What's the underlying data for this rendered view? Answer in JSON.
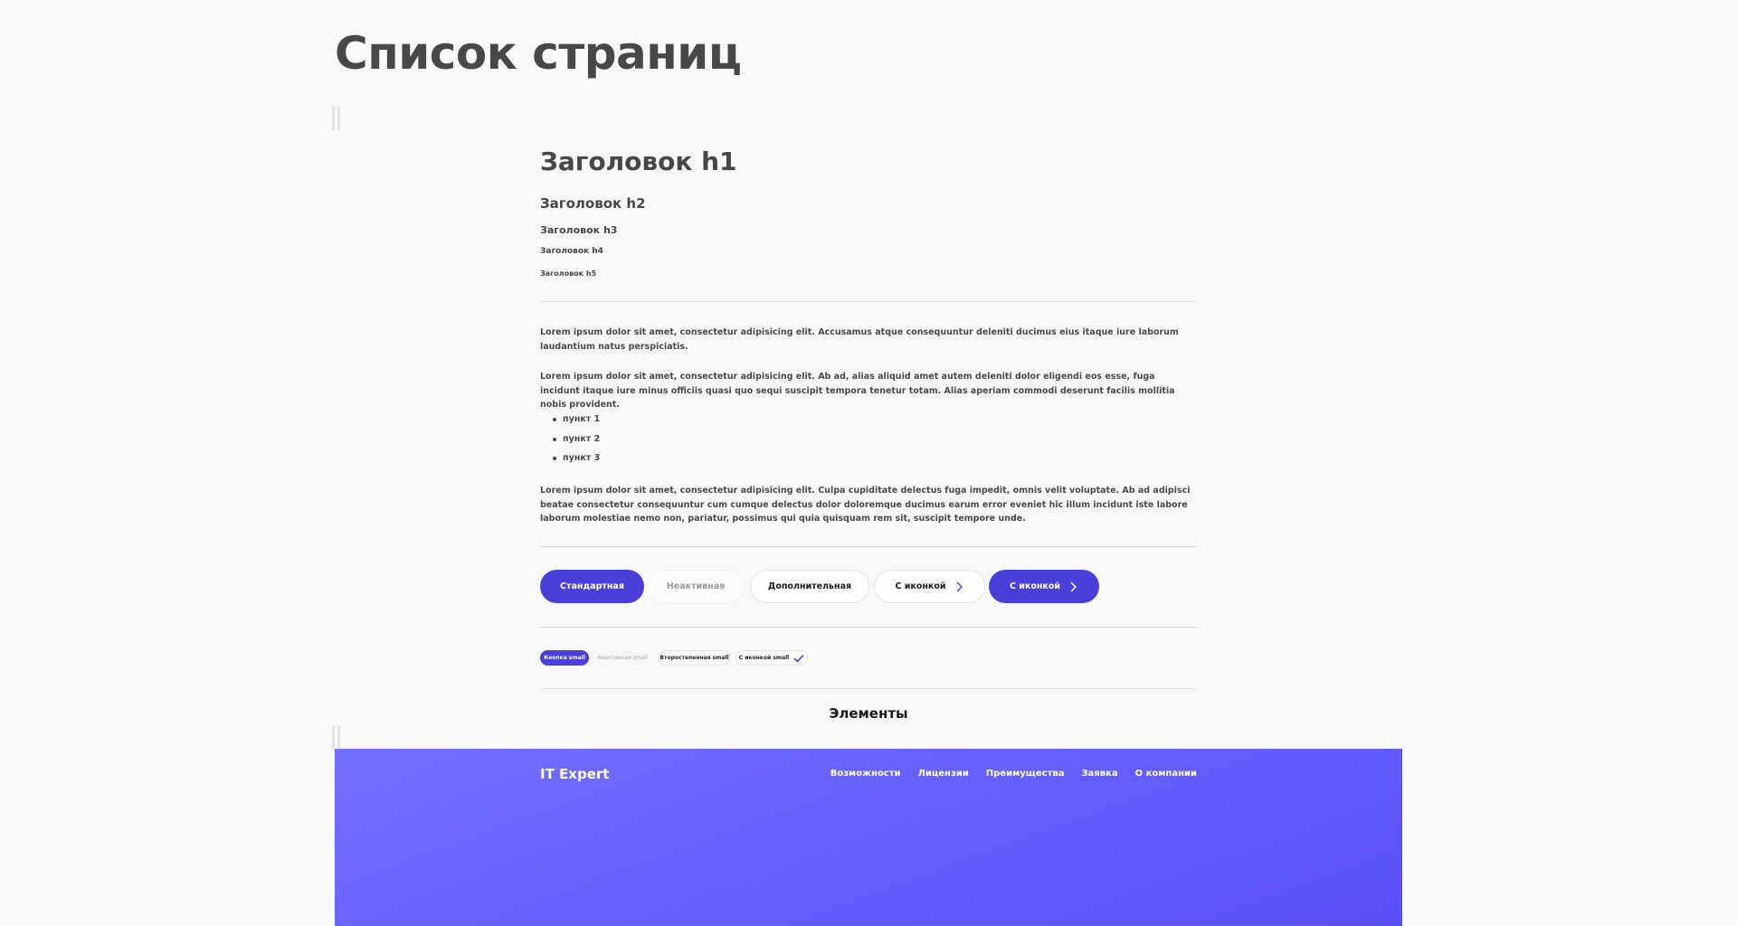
{
  "page": {
    "title": "Список страниц"
  },
  "typography": {
    "h1": "Заголовок h1",
    "h2": "Заголовок h2",
    "h3": "Заголовок h3",
    "h4": "Заголовок h4",
    "h5": "Заголовок h5"
  },
  "paragraphs": [
    "Lorem ipsum dolor sit amet, consectetur adipisicing elit. Accusamus atque consequuntur deleniti ducimus eius itaque iure laborum laudantium natus perspiciatis.",
    "Lorem ipsum dolor sit amet, consectetur adipisicing elit. Ab ad, alias aliquid amet autem deleniti dolor eligendi eos esse, fuga incidunt itaque iure minus officiis quasi quo sequi suscipit tempora tenetur totam. Alias aperiam commodi deserunt facilis mollitia nobis provident.",
    "Lorem ipsum dolor sit amet, consectetur adipisicing elit. Culpa cupiditate delectus fuga impedit, omnis velit voluptate. Ab ad adipisci beatae consectetur consequuntur cum cumque delectus dolor doloremque ducimus earum error eveniet hic illum incidunt iste labore laborum molestiae nemo non, pariatur, possimus qui quia quisquam rem sit, suscipit tempore unde."
  ],
  "list": [
    "пункт 1",
    "пункт 2",
    "пункт 3"
  ],
  "buttons": {
    "standard": "Стандартная",
    "inactive": "Неактивная",
    "additional": "Дополнительная",
    "with_icon_outline": "С иконкой",
    "with_icon_primary": "С иконкой"
  },
  "small_buttons": {
    "primary": "Кнопка small",
    "inactive": "Неактивная small",
    "secondary": "Второстепенная small",
    "with_icon": "С иконкой small"
  },
  "section": {
    "elements_title": "Элементы"
  },
  "footer": {
    "logo": "IT Expert",
    "nav": [
      "Возможности",
      "Лицензии",
      "Преимущества",
      "Заявка",
      "О компании"
    ]
  },
  "colors": {
    "accent": "#4a3fd9",
    "footer_gradient_start": "#7470ff",
    "footer_gradient_end": "#5a50f6"
  },
  "icons": {
    "button_icon": "chevron-right-icon",
    "small_button_icon": "check-icon"
  }
}
